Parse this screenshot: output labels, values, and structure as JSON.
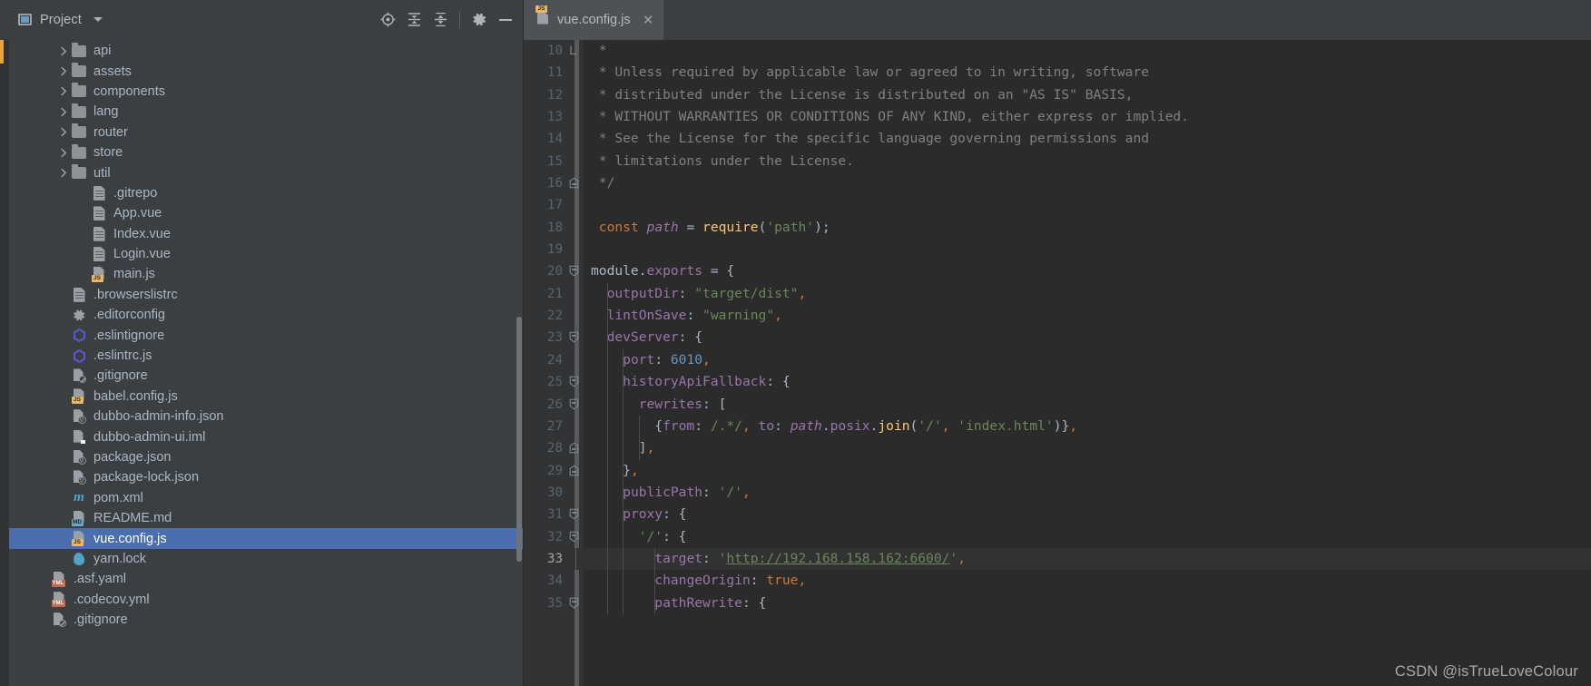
{
  "panel": {
    "title": "Project",
    "caret_icon": "chevron-down-icon",
    "tools": [
      {
        "name": "scroll-from-source-icon",
        "label": "Scroll from Source"
      },
      {
        "name": "expand-all-icon",
        "label": "Expand All"
      },
      {
        "name": "collapse-all-icon",
        "label": "Collapse All"
      },
      {
        "name": "settings-gear-icon",
        "label": "Settings"
      },
      {
        "name": "hide-panel-icon",
        "label": "Hide"
      }
    ]
  },
  "tree": {
    "items": [
      {
        "label": "api",
        "icon": "folder-icon",
        "indent": 2,
        "arrow": true,
        "selected": false
      },
      {
        "label": "assets",
        "icon": "folder-icon",
        "indent": 2,
        "arrow": true,
        "selected": false
      },
      {
        "label": "components",
        "icon": "folder-icon",
        "indent": 2,
        "arrow": true,
        "selected": false
      },
      {
        "label": "lang",
        "icon": "folder-icon",
        "indent": 2,
        "arrow": true,
        "selected": false
      },
      {
        "label": "router",
        "icon": "folder-icon",
        "indent": 2,
        "arrow": true,
        "selected": false
      },
      {
        "label": "store",
        "icon": "folder-icon",
        "indent": 2,
        "arrow": true,
        "selected": false
      },
      {
        "label": "util",
        "icon": "folder-icon",
        "indent": 2,
        "arrow": true,
        "selected": false
      },
      {
        "label": ".gitrepo",
        "icon": "file-icon",
        "indent": 3,
        "arrow": false,
        "selected": false
      },
      {
        "label": "App.vue",
        "icon": "file-icon",
        "indent": 3,
        "arrow": false,
        "selected": false
      },
      {
        "label": "Index.vue",
        "icon": "file-icon",
        "indent": 3,
        "arrow": false,
        "selected": false
      },
      {
        "label": "Login.vue",
        "icon": "file-icon",
        "indent": 3,
        "arrow": false,
        "selected": false
      },
      {
        "label": "main.js",
        "icon": "js-file-icon",
        "indent": 3,
        "arrow": false,
        "selected": false
      },
      {
        "label": ".browserslistrc",
        "icon": "file-icon",
        "indent": 2,
        "arrow": false,
        "selected": false
      },
      {
        "label": ".editorconfig",
        "icon": "gear-file-icon",
        "indent": 2,
        "arrow": false,
        "selected": false
      },
      {
        "label": ".eslintignore",
        "icon": "eslint-icon",
        "indent": 2,
        "arrow": false,
        "selected": false
      },
      {
        "label": ".eslintrc.js",
        "icon": "eslint-icon",
        "indent": 2,
        "arrow": false,
        "selected": false
      },
      {
        "label": ".gitignore",
        "icon": "gitignore-icon",
        "indent": 2,
        "arrow": false,
        "selected": false
      },
      {
        "label": "babel.config.js",
        "icon": "js-file-icon",
        "indent": 2,
        "arrow": false,
        "selected": false
      },
      {
        "label": "dubbo-admin-info.json",
        "icon": "json-file-icon",
        "indent": 2,
        "arrow": false,
        "selected": false
      },
      {
        "label": "dubbo-admin-ui.iml",
        "icon": "iml-file-icon",
        "indent": 2,
        "arrow": false,
        "selected": false
      },
      {
        "label": "package.json",
        "icon": "json-file-icon",
        "indent": 2,
        "arrow": false,
        "selected": false
      },
      {
        "label": "package-lock.json",
        "icon": "json-file-icon",
        "indent": 2,
        "arrow": false,
        "selected": false
      },
      {
        "label": "pom.xml",
        "icon": "maven-file-icon",
        "indent": 2,
        "arrow": false,
        "selected": false
      },
      {
        "label": "README.md",
        "icon": "md-file-icon",
        "indent": 2,
        "arrow": false,
        "selected": false
      },
      {
        "label": "vue.config.js",
        "icon": "js-file-icon",
        "indent": 2,
        "arrow": false,
        "selected": true
      },
      {
        "label": "yarn.lock",
        "icon": "yarn-file-icon",
        "indent": 2,
        "arrow": false,
        "selected": false
      },
      {
        "label": ".asf.yaml",
        "icon": "yaml-file-icon",
        "indent": 1,
        "arrow": false,
        "selected": false
      },
      {
        "label": ".codecov.yml",
        "icon": "yaml-file-icon",
        "indent": 1,
        "arrow": false,
        "selected": false
      },
      {
        "label": ".gitignore",
        "icon": "gitignore-icon",
        "indent": 1,
        "arrow": false,
        "selected": false
      }
    ]
  },
  "tabs": [
    {
      "label": "vue.config.js",
      "icon": "js-file-icon",
      "close_icon": "close-icon",
      "active": true
    }
  ],
  "editor": {
    "first_line": 10,
    "highlight_line": 33,
    "lines": [
      {
        "n": 10,
        "fold": "fold-end",
        "tokens": [
          {
            "t": " * ",
            "c": "t-comment"
          }
        ]
      },
      {
        "n": 11,
        "fold": "",
        "tokens": [
          {
            "t": " * Unless required by applicable law or agreed to in writing, software",
            "c": "t-comment"
          }
        ]
      },
      {
        "n": 12,
        "fold": "",
        "tokens": [
          {
            "t": " * distributed under the License is distributed on an \"AS IS\" BASIS,",
            "c": "t-comment"
          }
        ]
      },
      {
        "n": 13,
        "fold": "",
        "tokens": [
          {
            "t": " * WITHOUT WARRANTIES OR CONDITIONS OF ANY KIND, either express or implied.",
            "c": "t-comment"
          }
        ]
      },
      {
        "n": 14,
        "fold": "",
        "tokens": [
          {
            "t": " * See the License for the specific language governing permissions and",
            "c": "t-comment"
          }
        ]
      },
      {
        "n": 15,
        "fold": "",
        "tokens": [
          {
            "t": " * limitations under the License.",
            "c": "t-comment"
          }
        ]
      },
      {
        "n": 16,
        "fold": "fold-close",
        "tokens": [
          {
            "t": " */",
            "c": "t-comment"
          }
        ]
      },
      {
        "n": 17,
        "fold": "",
        "tokens": []
      },
      {
        "n": 18,
        "fold": "",
        "tokens": [
          {
            "t": " ",
            "c": "t-plain"
          },
          {
            "t": "const",
            "c": "t-keyword"
          },
          {
            "t": " ",
            "c": "t-plain"
          },
          {
            "t": "path",
            "c": "t-italic-f"
          },
          {
            "t": " = ",
            "c": "t-plain"
          },
          {
            "t": "require",
            "c": "t-func"
          },
          {
            "t": "(",
            "c": "t-plain"
          },
          {
            "t": "'path'",
            "c": "t-string"
          },
          {
            "t": ");",
            "c": "t-plain"
          }
        ]
      },
      {
        "n": 19,
        "fold": "",
        "tokens": []
      },
      {
        "n": 20,
        "fold": "fold-open",
        "tokens": [
          {
            "t": "module",
            "c": "t-plain"
          },
          {
            "t": ".",
            "c": "t-plain"
          },
          {
            "t": "exports",
            "c": "t-prop"
          },
          {
            "t": " = {",
            "c": "t-plain"
          }
        ]
      },
      {
        "n": 21,
        "fold": "",
        "tokens": [
          {
            "t": "  ",
            "c": "t-plain"
          },
          {
            "t": "outputDir",
            "c": "t-prop"
          },
          {
            "t": ": ",
            "c": "t-plain"
          },
          {
            "t": "\"target/dist\"",
            "c": "t-string"
          },
          {
            "t": ",",
            "c": "t-comma"
          }
        ]
      },
      {
        "n": 22,
        "fold": "",
        "tokens": [
          {
            "t": "  ",
            "c": "t-plain"
          },
          {
            "t": "lintOnSave",
            "c": "t-prop"
          },
          {
            "t": ": ",
            "c": "t-plain"
          },
          {
            "t": "\"warning\"",
            "c": "t-string"
          },
          {
            "t": ",",
            "c": "t-comma"
          }
        ]
      },
      {
        "n": 23,
        "fold": "fold-open",
        "tokens": [
          {
            "t": "  ",
            "c": "t-plain"
          },
          {
            "t": "devServer",
            "c": "t-prop"
          },
          {
            "t": ": {",
            "c": "t-plain"
          }
        ]
      },
      {
        "n": 24,
        "fold": "",
        "tokens": [
          {
            "t": "    ",
            "c": "t-plain"
          },
          {
            "t": "port",
            "c": "t-prop"
          },
          {
            "t": ": ",
            "c": "t-plain"
          },
          {
            "t": "6010",
            "c": "t-num"
          },
          {
            "t": ",",
            "c": "t-comma"
          }
        ]
      },
      {
        "n": 25,
        "fold": "fold-open",
        "tokens": [
          {
            "t": "    ",
            "c": "t-plain"
          },
          {
            "t": "historyApiFallback",
            "c": "t-prop"
          },
          {
            "t": ": {",
            "c": "t-plain"
          }
        ]
      },
      {
        "n": 26,
        "fold": "fold-open",
        "tokens": [
          {
            "t": "      ",
            "c": "t-plain"
          },
          {
            "t": "rewrites",
            "c": "t-prop"
          },
          {
            "t": ": [",
            "c": "t-plain"
          }
        ]
      },
      {
        "n": 27,
        "fold": "",
        "tokens": [
          {
            "t": "        {",
            "c": "t-plain"
          },
          {
            "t": "from",
            "c": "t-prop"
          },
          {
            "t": ": ",
            "c": "t-plain"
          },
          {
            "t": "/.*/",
            "c": "t-regex"
          },
          {
            "t": ", ",
            "c": "t-comma"
          },
          {
            "t": "to",
            "c": "t-prop"
          },
          {
            "t": ": ",
            "c": "t-plain"
          },
          {
            "t": "path",
            "c": "t-italic-f"
          },
          {
            "t": ".",
            "c": "t-plain"
          },
          {
            "t": "posix",
            "c": "t-prop"
          },
          {
            "t": ".",
            "c": "t-plain"
          },
          {
            "t": "join",
            "c": "t-func"
          },
          {
            "t": "(",
            "c": "t-plain"
          },
          {
            "t": "'/'",
            "c": "t-string"
          },
          {
            "t": ", ",
            "c": "t-comma"
          },
          {
            "t": "'index.html'",
            "c": "t-string"
          },
          {
            "t": ")}",
            "c": "t-plain"
          },
          {
            "t": ",",
            "c": "t-comma"
          }
        ]
      },
      {
        "n": 28,
        "fold": "fold-close",
        "tokens": [
          {
            "t": "      ]",
            "c": "t-plain"
          },
          {
            "t": ",",
            "c": "t-comma"
          }
        ]
      },
      {
        "n": 29,
        "fold": "fold-close",
        "tokens": [
          {
            "t": "    }",
            "c": "t-plain"
          },
          {
            "t": ",",
            "c": "t-comma"
          }
        ]
      },
      {
        "n": 30,
        "fold": "",
        "tokens": [
          {
            "t": "    ",
            "c": "t-plain"
          },
          {
            "t": "publicPath",
            "c": "t-prop"
          },
          {
            "t": ": ",
            "c": "t-plain"
          },
          {
            "t": "'/'",
            "c": "t-string"
          },
          {
            "t": ",",
            "c": "t-comma"
          }
        ]
      },
      {
        "n": 31,
        "fold": "fold-open",
        "tokens": [
          {
            "t": "    ",
            "c": "t-plain"
          },
          {
            "t": "proxy",
            "c": "t-prop"
          },
          {
            "t": ": {",
            "c": "t-plain"
          }
        ]
      },
      {
        "n": 32,
        "fold": "fold-open",
        "tokens": [
          {
            "t": "      ",
            "c": "t-plain"
          },
          {
            "t": "'/'",
            "c": "t-string"
          },
          {
            "t": ": {",
            "c": "t-plain"
          }
        ]
      },
      {
        "n": 33,
        "fold": "",
        "tokens": [
          {
            "t": "        ",
            "c": "t-plain"
          },
          {
            "t": "target",
            "c": "t-prop"
          },
          {
            "t": ": ",
            "c": "t-plain"
          },
          {
            "t": "'",
            "c": "t-string"
          },
          {
            "t": "http://192.168.158.162:6600/",
            "c": "t-link"
          },
          {
            "t": "'",
            "c": "t-string"
          },
          {
            "t": ",",
            "c": "t-comma"
          }
        ]
      },
      {
        "n": 34,
        "fold": "",
        "tokens": [
          {
            "t": "        ",
            "c": "t-plain"
          },
          {
            "t": "changeOrigin",
            "c": "t-prop"
          },
          {
            "t": ": ",
            "c": "t-plain"
          },
          {
            "t": "true",
            "c": "t-keyword"
          },
          {
            "t": ",",
            "c": "t-comma"
          }
        ]
      },
      {
        "n": 35,
        "fold": "fold-open",
        "tokens": [
          {
            "t": "        ",
            "c": "t-plain"
          },
          {
            "t": "pathRewrite",
            "c": "t-prop"
          },
          {
            "t": ": {",
            "c": "t-plain"
          }
        ]
      }
    ]
  },
  "watermark": "CSDN @isTrueLoveColour"
}
